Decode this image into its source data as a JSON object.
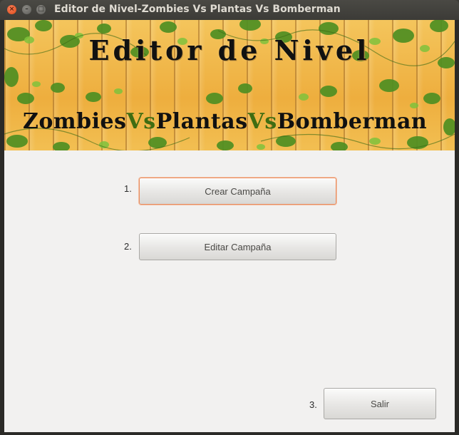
{
  "window": {
    "title": "Editor de Nivel-Zombies Vs Plantas Vs Bomberman",
    "controls": [
      "close-icon",
      "minimize-icon",
      "maximize-icon"
    ]
  },
  "banner": {
    "title": "Editor de Nivel",
    "subtitle_parts": [
      "Zombies",
      "Vs",
      "Plantas",
      "Vs",
      "Bomberman"
    ]
  },
  "menu": {
    "items": [
      {
        "number": "1.",
        "label": "Crear Campaña",
        "focused": true
      },
      {
        "number": "2.",
        "label": "Editar Campaña",
        "focused": false
      }
    ],
    "exit": {
      "number": "3.",
      "label": "Salir"
    }
  },
  "colors": {
    "vs": "#3f6d12",
    "focus_border": "#e98b5d",
    "background": "#f2f1f0"
  }
}
